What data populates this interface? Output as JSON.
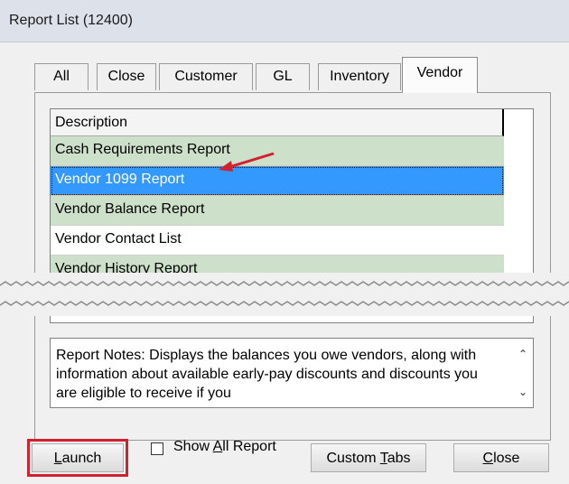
{
  "window": {
    "title": "Report List (12400)"
  },
  "tabs": [
    {
      "label": "All",
      "active": false
    },
    {
      "label": "Close",
      "active": false
    },
    {
      "label": "Customer",
      "active": false
    },
    {
      "label": "GL",
      "active": false
    },
    {
      "label": "Inventory",
      "active": false
    },
    {
      "label": "Vendor",
      "active": true
    }
  ],
  "report_grid": {
    "header": "Description",
    "rows": [
      {
        "label": "Cash Requirements Report",
        "style": "green"
      },
      {
        "label": "Vendor 1099 Report",
        "style": "selected"
      },
      {
        "label": "Vendor Balance Report",
        "style": "green"
      },
      {
        "label": "Vendor Contact List",
        "style": "white"
      },
      {
        "label": "Vendor History Report",
        "style": "green"
      }
    ]
  },
  "notes": {
    "text": "Report Notes:  Displays the balances you owe vendors, along with information about available early-pay discounts and discounts you are eligible to receive if you"
  },
  "buttons": {
    "launch": {
      "pre": "",
      "mnemonic": "L",
      "post": "aunch"
    },
    "show_all": {
      "pre": "Show ",
      "mnemonic": "A",
      "post": "ll Report",
      "checked": false
    },
    "custom_tabs": {
      "pre": "Custom ",
      "mnemonic": "T",
      "post": "abs"
    },
    "close": {
      "pre": "",
      "mnemonic": "C",
      "post": "lose"
    }
  },
  "colors": {
    "row_green": "#cde0c9",
    "row_selected": "#3399ff",
    "annotation_red": "#d2202e"
  },
  "icons": {
    "scroll_up": "chevron-up-icon",
    "scroll_down": "chevron-down-icon",
    "annotation": "red-arrow-icon"
  }
}
